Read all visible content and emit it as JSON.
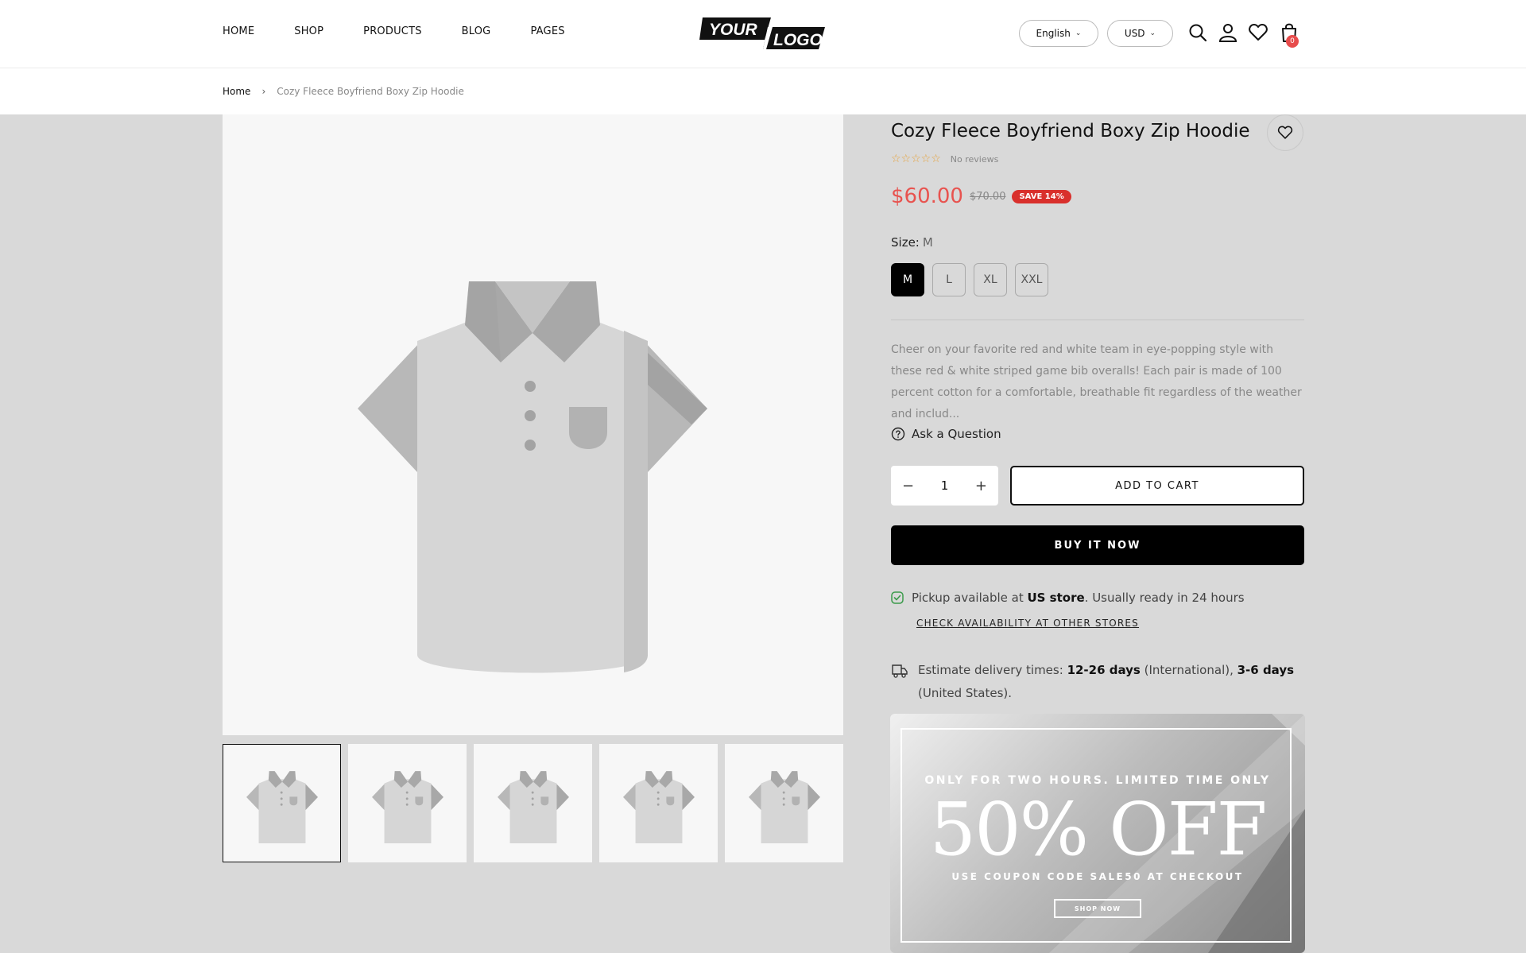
{
  "header": {
    "nav": [
      "HOME",
      "SHOP",
      "PRODUCTS",
      "BLOG",
      "PAGES"
    ],
    "logo_text": [
      "YOUR",
      "LOGO"
    ],
    "language": "English",
    "currency": "USD",
    "cart_count": "0",
    "icons": [
      "search-icon",
      "user-icon",
      "heart-icon",
      "cart-icon"
    ]
  },
  "breadcrumb": {
    "home": "Home",
    "separator": "›",
    "current": "Cozy Fleece Boyfriend Boxy Zip Hoodie"
  },
  "product": {
    "title": "Cozy Fleece Boyfriend Boxy Zip Hoodie",
    "rating_stars": "☆☆☆☆☆",
    "reviews": "No reviews",
    "price": "$60.00",
    "compare_price": "$70.00",
    "save_badge": "SAVE 14%",
    "size_label": "Size:",
    "size_selected": "M",
    "sizes": [
      "M",
      "L",
      "XL",
      "XXL"
    ],
    "description": "Cheer on your favorite red and white team in eye-popping style with these red & white striped game bib overalls! Each pair is made of 100 percent cotton for a comfortable, breathable fit regardless of the weather and includ...",
    "ask_question": "Ask a Question",
    "quantity": "1",
    "add_to_cart": "ADD TO CART",
    "buy_now": "BUY IT NOW",
    "pickup_prefix": "Pickup available at ",
    "pickup_store": "US store",
    "pickup_suffix": ". Usually ready in 24 hours",
    "check_availability": "CHECK AVAILABILITY AT OTHER STORES",
    "delivery_prefix": "Estimate delivery times: ",
    "delivery_intl_days": "12-26 days",
    "delivery_intl": " (International), ",
    "delivery_us_days": "3-6 days",
    "delivery_us": " (United States)."
  },
  "gallery": {
    "thumbnail_count": 5,
    "active_index": 0
  },
  "promo": {
    "top_line": "ONLY FOR TWO HOURS. LIMITED TIME ONLY",
    "headline": "50% OFF",
    "code_line": "USE COUPON CODE SALE50 AT CHECKOUT",
    "button": "SHOP NOW"
  },
  "colors": {
    "accent_price": "#e8534f",
    "save_badge": "#d9302c",
    "stars": "#e6a23c",
    "pickup_check": "#3a9a4a",
    "buy_button": "#000000"
  }
}
